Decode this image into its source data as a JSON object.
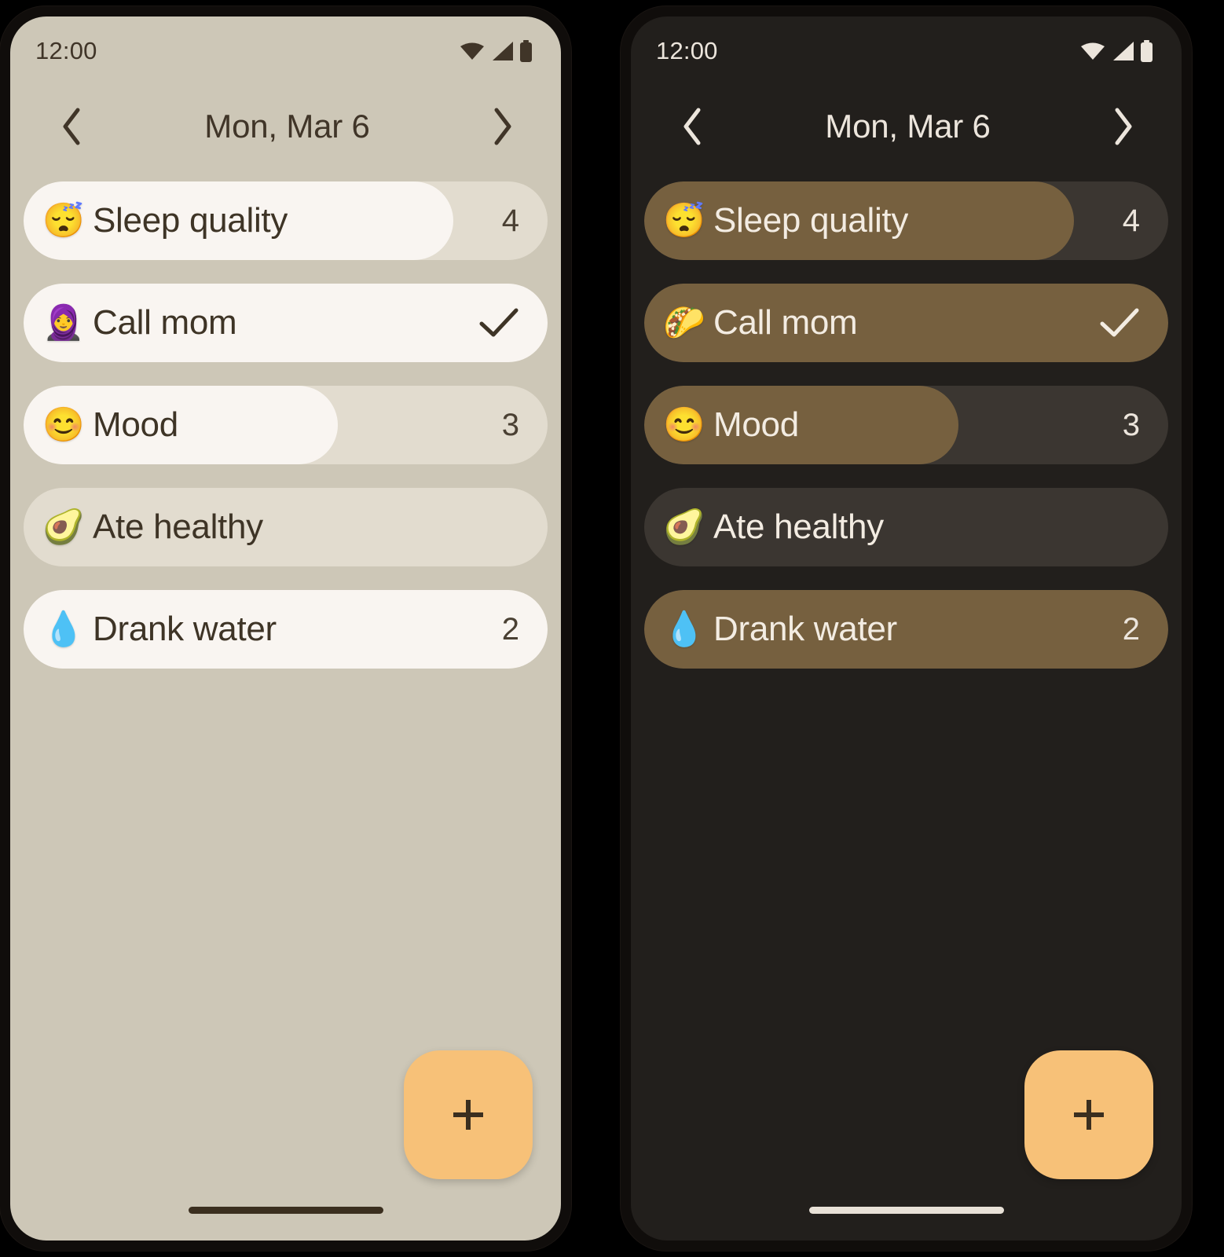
{
  "theme_variants": [
    {
      "id": "light",
      "name": "Light theme",
      "colors": {
        "background": "#cdc7b7",
        "track": "#e2dccf",
        "fill": "#f9f5f1",
        "text": "#403528",
        "fab": "#f7c178",
        "home_indicator": "#3b2f1f"
      },
      "statusbar": {
        "time": "12:00",
        "icons": [
          "wifi-icon",
          "cellular-signal-icon",
          "battery-icon"
        ]
      },
      "header": {
        "prev_label": "‹",
        "title": "Mon, Mar 6",
        "next_label": "›"
      },
      "habits": [
        {
          "emoji": "😴",
          "emoji_name": "sleeping-face-emoji",
          "name": "Sleep quality",
          "value": "4",
          "trailing_type": "value",
          "fill_percent": 82
        },
        {
          "emoji": "🧕",
          "emoji_name": "woman-with-headscarf-emoji",
          "name": "Call mom",
          "value": "✓",
          "trailing_type": "check",
          "fill_percent": 100
        },
        {
          "emoji": "😊",
          "emoji_name": "smiling-face-emoji",
          "name": "Mood",
          "value": "3",
          "trailing_type": "value",
          "fill_percent": 60
        },
        {
          "emoji": "🥑",
          "emoji_name": "avocado-emoji",
          "name": "Ate healthy",
          "value": "",
          "trailing_type": "none",
          "fill_percent": 0
        },
        {
          "emoji": "💧",
          "emoji_name": "droplet-emoji",
          "name": "Drank water",
          "value": "2",
          "trailing_type": "value",
          "fill_percent": 100
        }
      ],
      "fab": {
        "label": "+",
        "name": "add-habit-button"
      }
    },
    {
      "id": "dark",
      "name": "Dark theme",
      "colors": {
        "background": "#221f1c",
        "track": "#3b3631",
        "fill": "#76603f",
        "text": "#ece5dc",
        "fab": "#f7c178",
        "home_indicator": "#e8e1d7"
      },
      "statusbar": {
        "time": "12:00",
        "icons": [
          "wifi-icon",
          "cellular-signal-icon",
          "battery-icon"
        ]
      },
      "header": {
        "prev_label": "‹",
        "title": "Mon, Mar 6",
        "next_label": "›"
      },
      "habits": [
        {
          "emoji": "😴",
          "emoji_name": "sleeping-face-emoji",
          "name": "Sleep quality",
          "value": "4",
          "trailing_type": "value",
          "fill_percent": 82
        },
        {
          "emoji": "🌮",
          "emoji_name": "taco-emoji",
          "name": "Call mom",
          "value": "✓",
          "trailing_type": "check",
          "fill_percent": 100
        },
        {
          "emoji": "😊",
          "emoji_name": "smiling-face-emoji",
          "name": "Mood",
          "value": "3",
          "trailing_type": "value",
          "fill_percent": 60
        },
        {
          "emoji": "🥑",
          "emoji_name": "avocado-emoji",
          "name": "Ate healthy",
          "value": "",
          "trailing_type": "none",
          "fill_percent": 0
        },
        {
          "emoji": "💧",
          "emoji_name": "droplet-emoji",
          "name": "Drank water",
          "value": "2",
          "trailing_type": "value",
          "fill_percent": 100
        }
      ],
      "fab": {
        "label": "+",
        "name": "add-habit-button"
      }
    }
  ]
}
